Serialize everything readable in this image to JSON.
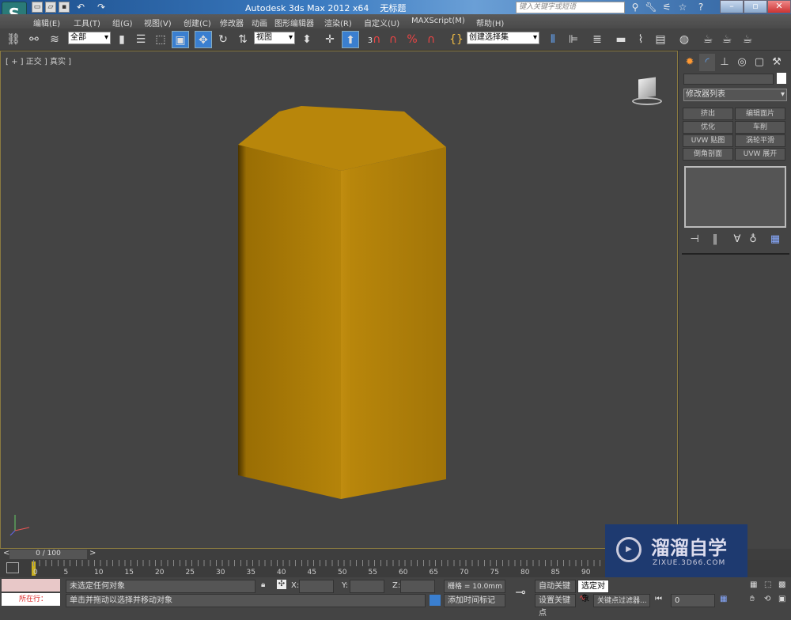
{
  "app": {
    "title": "Autodesk 3ds Max  2012 x64",
    "doc": "无标题",
    "logo": "S"
  },
  "search": {
    "placeholder": "键入关键字或短语"
  },
  "menu": [
    "编辑(E)",
    "工具(T)",
    "组(G)",
    "视图(V)",
    "创建(C)",
    "修改器",
    "动画",
    "图形编辑器",
    "渲染(R)",
    "自定义(U)",
    "MAXScript(M)",
    "帮助(H)"
  ],
  "toolbar": {
    "filter": "全部",
    "refcoord": "视图",
    "selset": "创建选择集",
    "snap": "3"
  },
  "viewport": {
    "label": "[ + ] 正交 ] 真实 ]",
    "object_color": "#b8860b"
  },
  "command_panel": {
    "modifier_list": "修改器列表",
    "buttons": [
      "挤出",
      "编辑面片",
      "优化",
      "车削",
      "UVW 贴图",
      "涡轮平滑",
      "倒角剖面",
      "UVW 展开"
    ]
  },
  "timeline": {
    "position": "0 / 100",
    "ticks": [
      "0",
      "5",
      "10",
      "15",
      "20",
      "25",
      "30",
      "35",
      "40",
      "45",
      "50",
      "55",
      "60",
      "65",
      "70",
      "75",
      "80",
      "85",
      "90"
    ]
  },
  "status": {
    "script_line": "所在行：",
    "selection": "未选定任何对象",
    "prompt": "单击并拖动以选择并移动对象",
    "x_label": "X:",
    "y_label": "Y:",
    "z_label": "Z:",
    "grid": "栅格 = 10.0mm",
    "add_tag": "添加时间标记",
    "auto_key": "自动关键点",
    "set_key": "设置关键点",
    "key_mode": "选定对象",
    "key_filters": "关键点过滤器...",
    "frame": "0"
  },
  "watermark": {
    "name": "溜溜自学",
    "url": "ZIXUE.3D66.COM"
  }
}
